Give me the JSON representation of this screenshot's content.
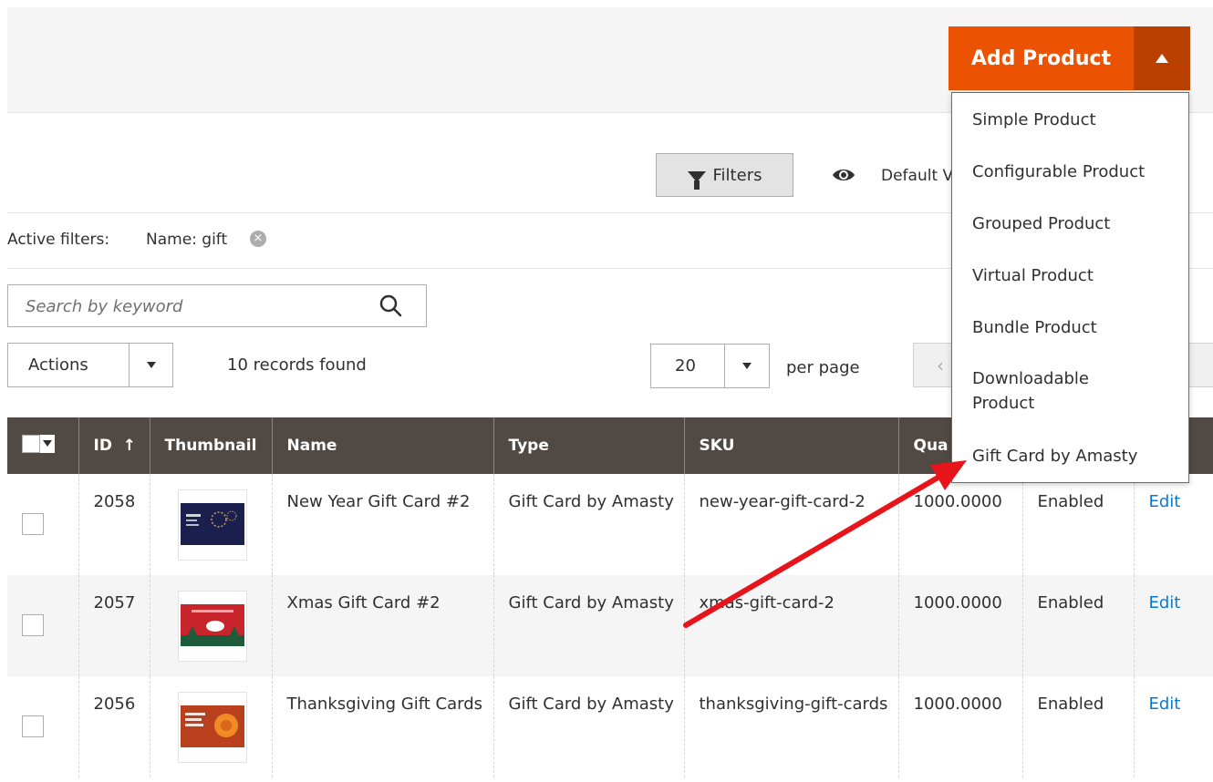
{
  "header": {
    "add_product_label": "Add Product"
  },
  "add_menu": {
    "items": [
      "Simple Product",
      "Configurable Product",
      "Grouped Product",
      "Virtual Product",
      "Bundle Product",
      "Downloadable Product",
      "Gift Card by Amasty"
    ]
  },
  "toolbar": {
    "filters_label": "Filters",
    "view_label": "Default V",
    "active_filters_label": "Active filters:",
    "active_filter_chip": "Name: gift",
    "search_placeholder": "Search by keyword",
    "actions_label": "Actions",
    "records_found": "10 records found",
    "per_page_value": "20",
    "per_page_label": "per page"
  },
  "grid": {
    "columns": [
      "ID",
      "Thumbnail",
      "Name",
      "Type",
      "SKU",
      "Qua"
    ],
    "sort_indicator": "↑",
    "rows": [
      {
        "id": "2058",
        "name": "New Year Gift Card #2",
        "type": "Gift Card by Amasty",
        "sku": "new-year-gift-card-2",
        "qty": "1000.0000",
        "status": "Enabled",
        "action": "Edit",
        "thumb_color": "#1b1f4d",
        "thumb_accent": "#c9a45c"
      },
      {
        "id": "2057",
        "name": "Xmas Gift Card #2",
        "type": "Gift Card by Amasty",
        "sku": "xmas-gift-card-2",
        "qty": "1000.0000",
        "status": "Enabled",
        "action": "Edit",
        "thumb_color": "#c8242b",
        "thumb_accent": "#1e5b3a"
      },
      {
        "id": "2056",
        "name": "Thanksgiving Gift Cards",
        "type": "Gift Card by Amasty",
        "sku": "thanksgiving-gift-cards",
        "qty": "1000.0000",
        "status": "Enabled",
        "action": "Edit",
        "thumb_color": "#b8401c",
        "thumb_accent": "#f08a24"
      }
    ]
  },
  "colors": {
    "accent": "#eb5202",
    "header_bg": "#514943",
    "link": "#007bdb",
    "annotation_arrow": "#e8141b"
  }
}
